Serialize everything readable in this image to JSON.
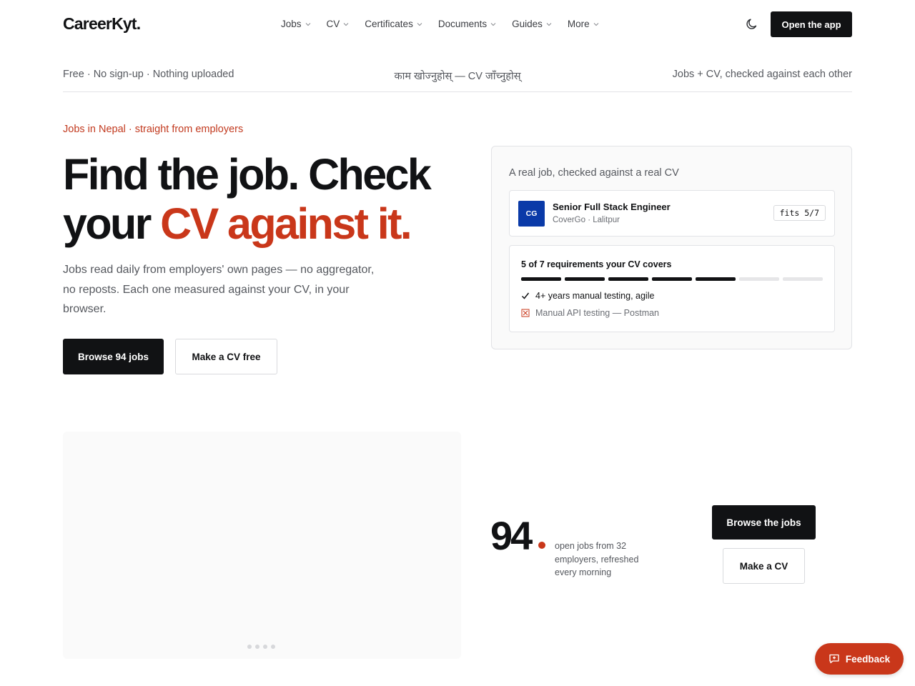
{
  "nav": {
    "logo": "CareerKyt.",
    "menu": [
      {
        "label": "Jobs"
      },
      {
        "label": "CV"
      },
      {
        "label": "Certificates"
      },
      {
        "label": "Documents"
      },
      {
        "label": "Guides"
      },
      {
        "label": "More"
      }
    ],
    "theme_icon": "moon-icon",
    "open_app": "Open the app"
  },
  "strip": {
    "left": "Free · No sign-up · Nothing uploaded",
    "middle": "काम खोज्नुहोस् — CV जाँच्नुहोस्",
    "right": "Jobs + CV, checked against each other"
  },
  "hero": {
    "eyebrow": "Jobs in Nepal · straight from employers",
    "headline_part1": "Find the job. Check your ",
    "headline_accent": "CV against it.",
    "lede": "Jobs read daily from employers' own pages — no aggregator, no reposts. Each one measured against your CV, in your browser.",
    "primary_button": "Browse 94 jobs",
    "secondary_button": "Make a CV free"
  },
  "demo": {
    "title": "A real job, checked against a real CV",
    "company_initials": "CG",
    "job_title": "Senior Full Stack Engineer",
    "job_meta": "CoverGo · Lalitpur",
    "fit_badge": "fits 5/7",
    "requirements_title": "5 of 7 requirements your CV covers",
    "requirements_total": 7,
    "requirements_met": 5,
    "requirement_met": "4+ years manual testing, agile",
    "requirement_missing": "Manual API testing — Postman",
    "brand_color": "#0a3aa8"
  },
  "stats": {
    "number": "94",
    "caption": "open jobs from 32 employers, refreshed every morning",
    "browse_button": "Browse the jobs",
    "make_cv_button": "Make a CV"
  },
  "carousel": {
    "dot_count": 4
  },
  "feedback": {
    "label": "Feedback",
    "icon": "message-plus-icon"
  },
  "colors": {
    "accent": "#c9371a",
    "ink": "#111214",
    "muted": "#55585e"
  }
}
